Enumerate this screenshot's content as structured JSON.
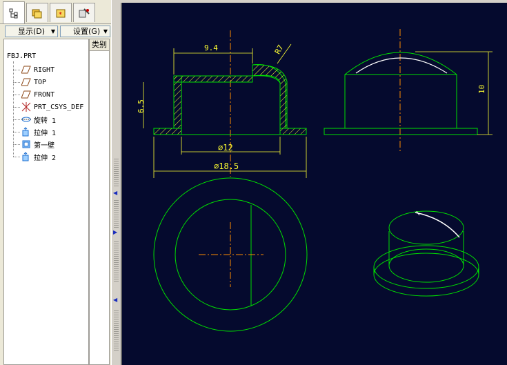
{
  "tabs": [
    {
      "name": "model-tree-tab",
      "icon": "model-tree-icon"
    },
    {
      "name": "folder-browser-tab",
      "icon": "folder-icon"
    },
    {
      "name": "favorites-tab",
      "icon": "favorites-icon"
    },
    {
      "name": "connections-tab",
      "icon": "connections-icon"
    }
  ],
  "toolbar": {
    "display_label": "显示(D)",
    "settings_label": "设置(G)"
  },
  "tree": {
    "column_header": "类别",
    "root": "FBJ.PRT",
    "items": [
      {
        "label": "RIGHT",
        "icon": "datum-plane-icon"
      },
      {
        "label": "TOP",
        "icon": "datum-plane-icon"
      },
      {
        "label": "FRONT",
        "icon": "datum-plane-icon"
      },
      {
        "label": "PRT_CSYS_DEF",
        "icon": "coordinate-system-icon"
      },
      {
        "label": "旋转 1",
        "icon": "revolve-icon"
      },
      {
        "label": "拉伸 1",
        "icon": "extrude-icon"
      },
      {
        "label": "第一壁",
        "icon": "shell-icon"
      },
      {
        "label": "拉伸 2",
        "icon": "extrude-icon"
      }
    ]
  },
  "drawing": {
    "dims": {
      "width_top": "9.4",
      "radius": "R7",
      "height_left": "6.5",
      "inner_dia": "⌀12",
      "outer_dia": "⌀18.5",
      "height_right": "10"
    },
    "colors": {
      "background": "#050a2e",
      "geometry": "#00e000",
      "dimension": "#ffff32",
      "centerline": "#ff8c00",
      "hatch": "#ffff32"
    }
  }
}
